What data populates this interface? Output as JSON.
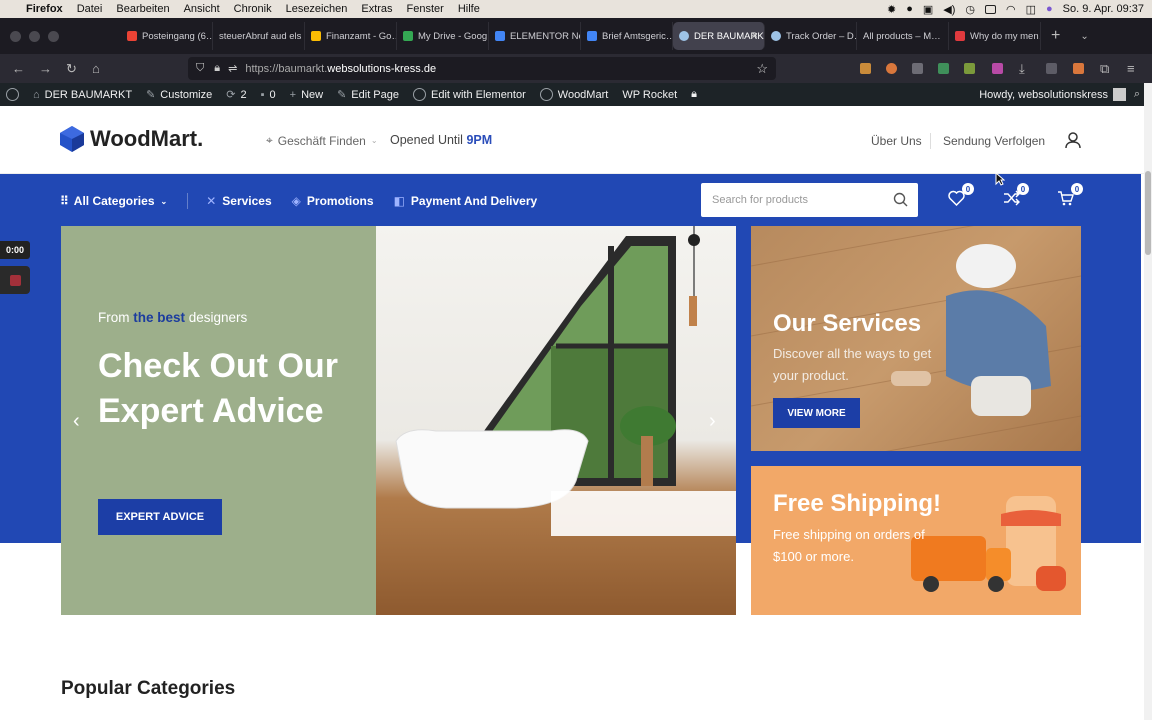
{
  "menubar": {
    "app": "Firefox",
    "items": [
      "Datei",
      "Bearbeiten",
      "Ansicht",
      "Chronik",
      "Lesezeichen",
      "Extras",
      "Fenster",
      "Hilfe"
    ],
    "datetime": "So. 9. Apr.  09:37"
  },
  "tabs": [
    {
      "label": "Posteingang (6…",
      "color": "#ea4335"
    },
    {
      "label": "steuerAbruf aud els",
      "color": "#1c1b22"
    },
    {
      "label": "Finanzamt - Go…",
      "color": "#fbbc04"
    },
    {
      "label": "My Drive - Goog…",
      "color": "#34a853"
    },
    {
      "label": "ELEMENTOR Ne…",
      "color": "#4285f4"
    },
    {
      "label": "Brief Amtsgeric…",
      "color": "#4285f4"
    },
    {
      "label": "DER BAUMARK…",
      "color": "#9ec3e6",
      "active": true
    },
    {
      "label": "Track Order – D…",
      "color": "#9ec3e6"
    },
    {
      "label": "All products – M…",
      "color": "#1c1b22"
    },
    {
      "label": "Why do my men…",
      "color": "#e03a3e"
    }
  ],
  "url": {
    "scheme": "https://baumarkt.",
    "host": "websolutions-kress.de"
  },
  "wpbar": {
    "site": "DER BAUMARKT",
    "customize": "Customize",
    "updates": "2",
    "comments": "0",
    "new": "New",
    "edit_page": "Edit Page",
    "elementor": "Edit with Elementor",
    "woodmart": "WoodMart",
    "rocket": "WP Rocket",
    "howdy": "Howdy, websolutionskress"
  },
  "header": {
    "logo": "WoodMart.",
    "find_store": "Geschäft Finden",
    "opened_prefix": "Opened Until ",
    "opened_time": "9PM",
    "about": "Über Uns",
    "tracking": "Sendung Verfolgen"
  },
  "nav": {
    "categories": "All Categories",
    "items": [
      "Services",
      "Promotions",
      "Payment And Delivery"
    ],
    "search_placeholder": "Search for products",
    "wishlist_count": "0",
    "compare_count": "0",
    "cart_count": "0"
  },
  "hero": {
    "tag_prefix": "From ",
    "tag_highlight": "the best",
    "tag_suffix": " designers",
    "title": "Check Out Our Expert Advice",
    "button": "EXPERT ADVICE"
  },
  "promo_services": {
    "title": "Our Services",
    "desc": "Discover all the ways to get your product.",
    "button": "VIEW MORE"
  },
  "promo_shipping": {
    "title": "Free Shipping!",
    "desc": "Free shipping on orders of $100 or more."
  },
  "popular_title": "Popular Categories",
  "recorder_time": "0:00",
  "colors": {
    "brand_blue": "#2148b4",
    "hero_green": "#9daf8b",
    "shipping_orange": "#f2a868"
  }
}
